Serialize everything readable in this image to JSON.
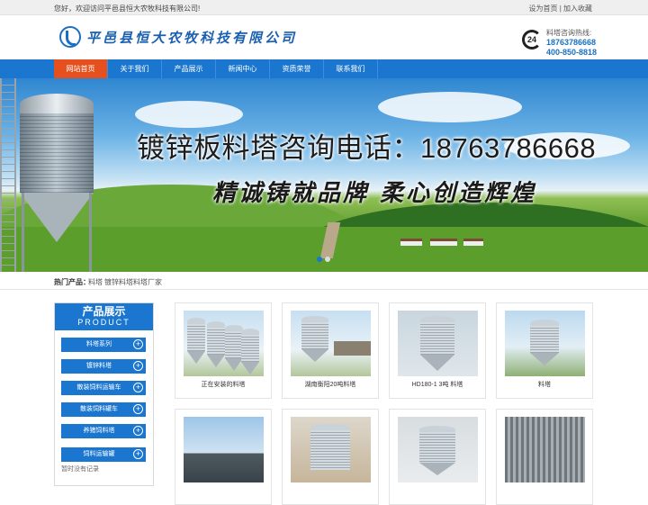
{
  "topbar": {
    "welcome": "您好，欢迎访问平邑县恒大农牧科技有限公司!",
    "set_home": "设为首页",
    "separator": " | ",
    "add_favorite": "加入收藏"
  },
  "header": {
    "company_name": "平邑县恒大农牧科技有限公司",
    "hotline_label": "料塔咨询热线:",
    "hotline_icon_text": "24",
    "phone_1": "18763786668",
    "phone_2": "400-850-8818"
  },
  "nav": {
    "items": [
      "网站首页",
      "关于我们",
      "产品展示",
      "新闻中心",
      "资质荣誉",
      "联系我们"
    ],
    "active_index": 0
  },
  "banner": {
    "headline": "镀锌板料塔咨询电话：18763786668",
    "slogan": "精诚铸就品牌 柔心创造辉煌",
    "slide_count": 2,
    "active_slide": 0
  },
  "hot_products": {
    "label": "热门产品：",
    "keywords": [
      "料塔",
      "镀锌料塔",
      "料塔厂家"
    ]
  },
  "sidebar": {
    "title": "产品展示",
    "subtitle": "PRODUCT",
    "items": [
      "料塔系列",
      "镀锌料塔",
      "散装饲料运输车",
      "散装饲料罐车",
      "养猪饲料塔",
      "饲料运输罐"
    ],
    "empty_note": "暂时没有记录",
    "plus_glyph": "+"
  },
  "products": [
    {
      "caption": "正在安装的料塔"
    },
    {
      "caption": "湖南衡阳20吨料塔"
    },
    {
      "caption": "HD180-1 3吨 料塔"
    },
    {
      "caption": "料塔"
    },
    {
      "caption": ""
    },
    {
      "caption": ""
    },
    {
      "caption": ""
    },
    {
      "caption": ""
    }
  ],
  "colors": {
    "primary_blue": "#1a76cf",
    "active_orange": "#e5501e",
    "phone_blue": "#1a6fc4"
  }
}
